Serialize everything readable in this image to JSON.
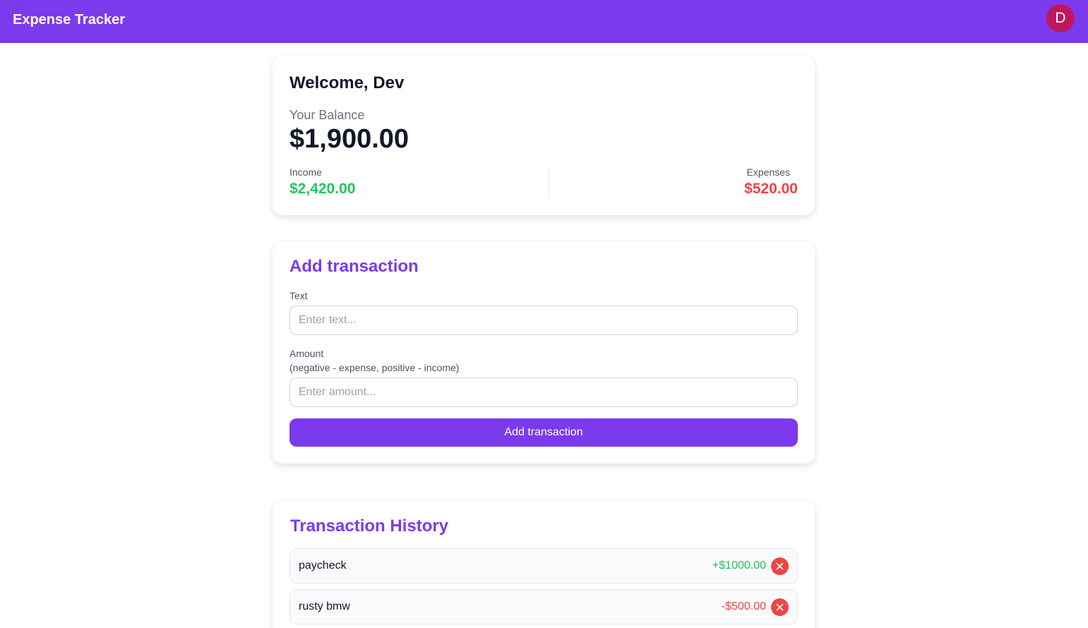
{
  "header": {
    "brand": "Expense Tracker",
    "avatar_letter": "D"
  },
  "summary": {
    "welcome": "Welcome, Dev",
    "balance_label": "Your Balance",
    "balance_value": "$1,900.00",
    "income_label": "Income",
    "income_value": "$2,420.00",
    "expense_label": "Expenses",
    "expense_value": "$520.00"
  },
  "add_form": {
    "title": "Add transaction",
    "text_label": "Text",
    "text_placeholder": "Enter text...",
    "text_value": "",
    "amount_label": "Amount",
    "amount_hint": "(negative - expense, positive - income)",
    "amount_placeholder": "Enter amount...",
    "amount_value": "",
    "submit_label": "Add transaction"
  },
  "history": {
    "title": "Transaction History",
    "items": [
      {
        "text": "paycheck",
        "amount": "+$1000.00",
        "type": "income",
        "delete_icon": "close-icon"
      },
      {
        "text": "rusty bmw",
        "amount": "-$500.00",
        "type": "expense",
        "delete_icon": "close-icon"
      }
    ]
  },
  "colors": {
    "accent": "#7c3aed",
    "avatar": "#be185d",
    "income": "#22c55e",
    "expense": "#ef4444"
  }
}
